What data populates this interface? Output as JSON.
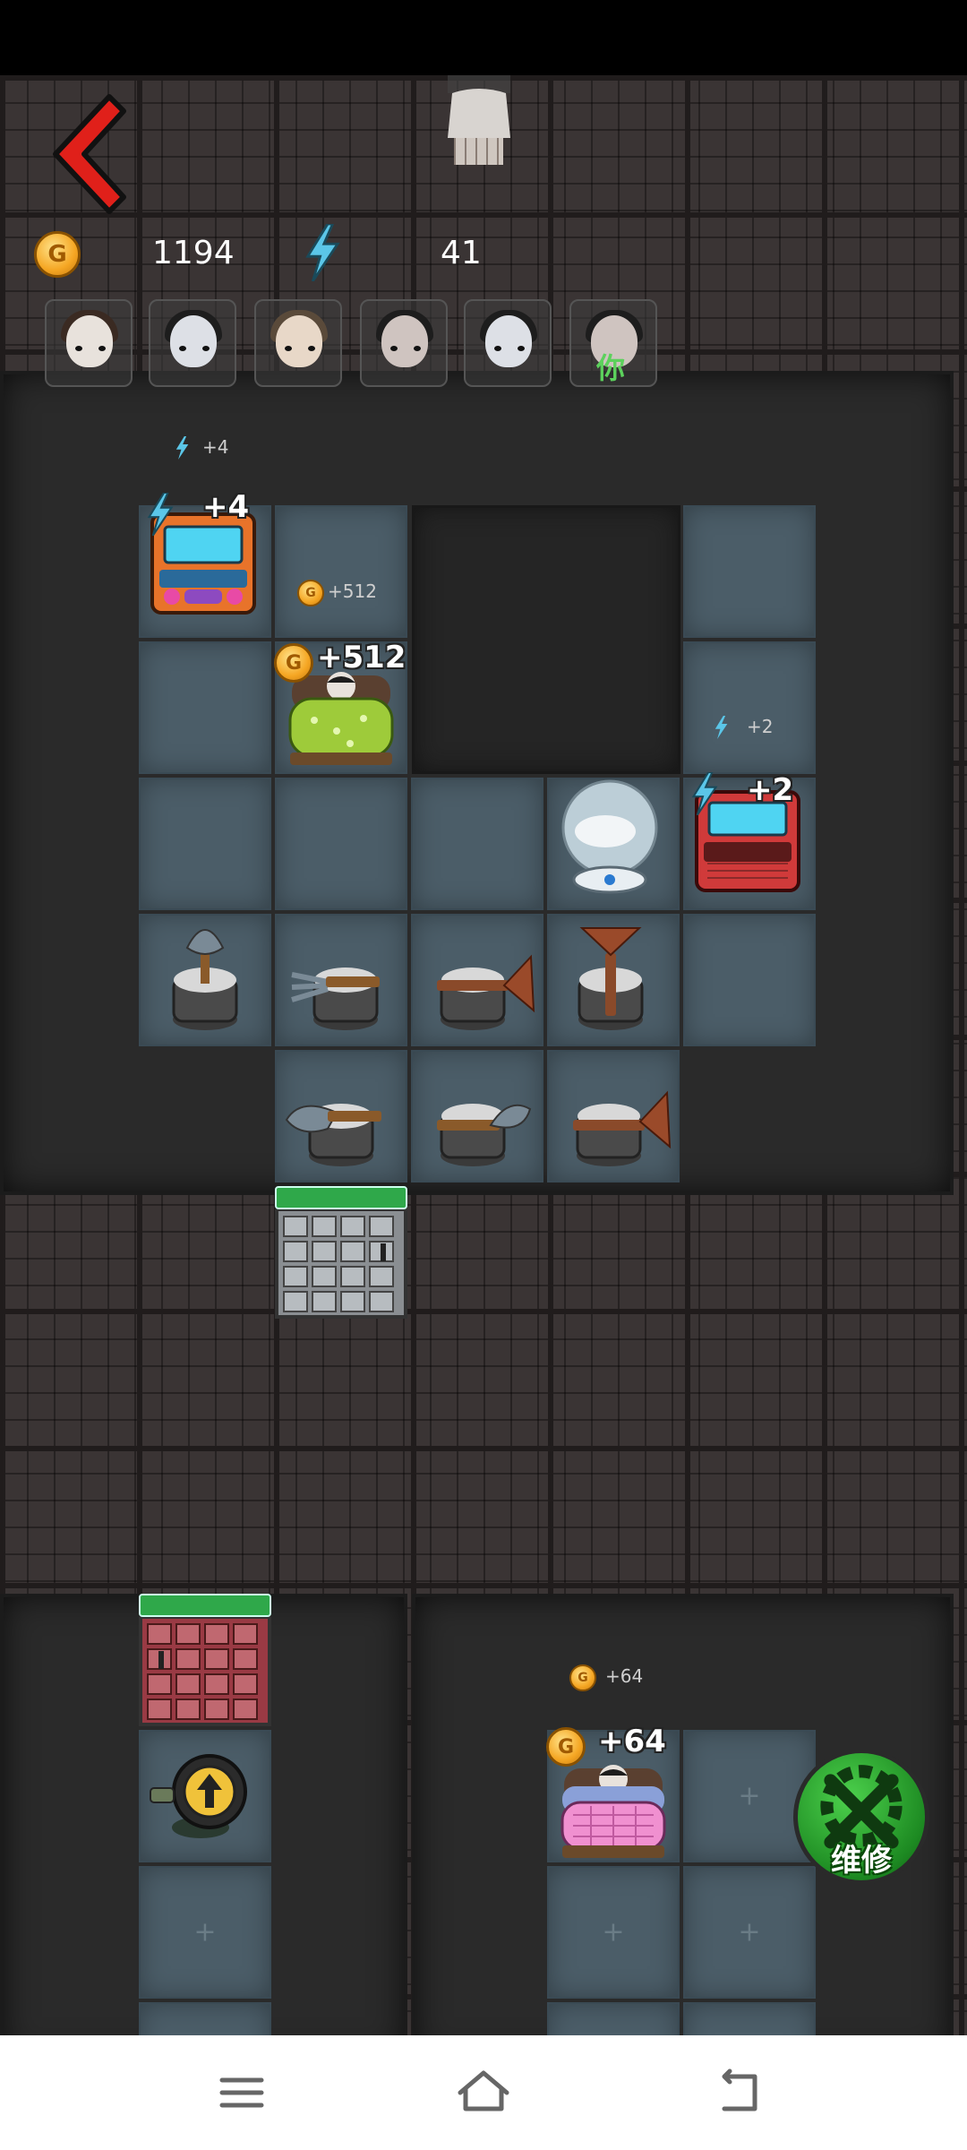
{
  "hud": {
    "gold": "1194",
    "energy": "41",
    "coin_letter": "G"
  },
  "characters": [
    {
      "name": "girl-1",
      "you": false
    },
    {
      "name": "ghost-1",
      "you": false
    },
    {
      "name": "girl-2",
      "you": false
    },
    {
      "name": "girl-3",
      "you": false
    },
    {
      "name": "ghost-2",
      "you": false
    },
    {
      "name": "player",
      "you": true,
      "label": "你"
    }
  ],
  "popups": {
    "arcade1_small": "+4",
    "arcade1_big": "+4",
    "bed1_small": "+512",
    "bed1_big": "+512",
    "arcade2_small": "+2",
    "arcade2_big": "+2",
    "bed2_small": "+64",
    "bed2_big": "+64"
  },
  "repair": {
    "label": "维修"
  },
  "colors": {
    "accent_green": "#2fa84a",
    "gold": "#f5a623",
    "energy": "#5bc6e8",
    "back_red": "#e0201a"
  },
  "icons": [
    "back-arrow-icon",
    "coin-icon",
    "lightning-icon",
    "upgrade-arrow-icon",
    "wrench-gear-icon",
    "menu-icon",
    "home-icon",
    "return-icon"
  ]
}
